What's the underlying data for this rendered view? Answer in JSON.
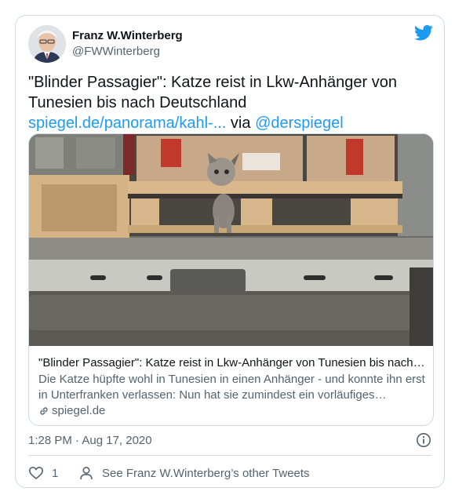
{
  "tweet": {
    "author_name": "Franz W.Winterberg",
    "author_handle": "@FWWinterberg",
    "text_quote": "\"Blinder Passagier\": Katze reist in Lkw-Anhänger von Tunesien bis nach Deutschland ",
    "text_link": "spiegel.de/panorama/kahl-...",
    "text_via": " via ",
    "text_mention": "@derspiegel",
    "timestamp": "1:28 PM · Aug 17, 2020",
    "like_count": "1",
    "profile_link": "See Franz W.Winterberg’s other Tweets"
  },
  "link_card": {
    "title": "\"Blinder Passagier\": Katze reist in Lkw-Anhänger von Tunesien bis nach U...",
    "description": "Die Katze hüpfte wohl in Tunesien in einen Anhänger - und konnte ihn erst in Unterfranken verlassen: Nun hat sie zumindest ein vorläufiges Zuhause...",
    "domain": "spiegel.de"
  },
  "icons": {
    "brand": "twitter-bird-icon",
    "info": "info-icon",
    "like": "heart-icon",
    "profile": "person-icon",
    "link": "chain-link-icon"
  },
  "colors": {
    "accent": "#1d9bf0",
    "text": "#0f1419",
    "muted": "#536471",
    "border": "#cfd9de"
  }
}
